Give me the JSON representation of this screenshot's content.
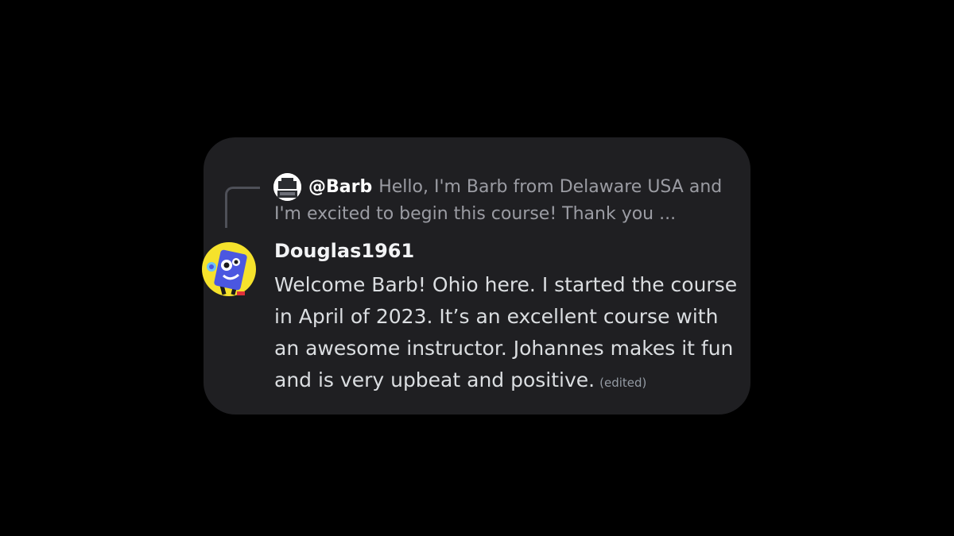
{
  "reply": {
    "author": "@Barb",
    "preview_line1": "Hello, I'm Barb from Delaware USA and",
    "preview_line2": "I'm excited to begin this course! Thank you ..."
  },
  "message": {
    "author": "Douglas1961",
    "lines": [
      "Welcome Barb! Ohio here. I started the course",
      "in April of 2023. It’s an excellent course with",
      "an awesome instructor. Johannes makes it fun",
      "and is very upbeat and positive."
    ],
    "edited_label": "(edited)"
  },
  "icons": {
    "reply_avatar": "reply-user-avatar-icon",
    "main_avatar": "blue-robot-avatar-icon"
  },
  "colors": {
    "background": "#000000",
    "card": "#1f1f22",
    "avatar_yellow": "#f5e22c",
    "robot_blue": "#4b57e0"
  }
}
